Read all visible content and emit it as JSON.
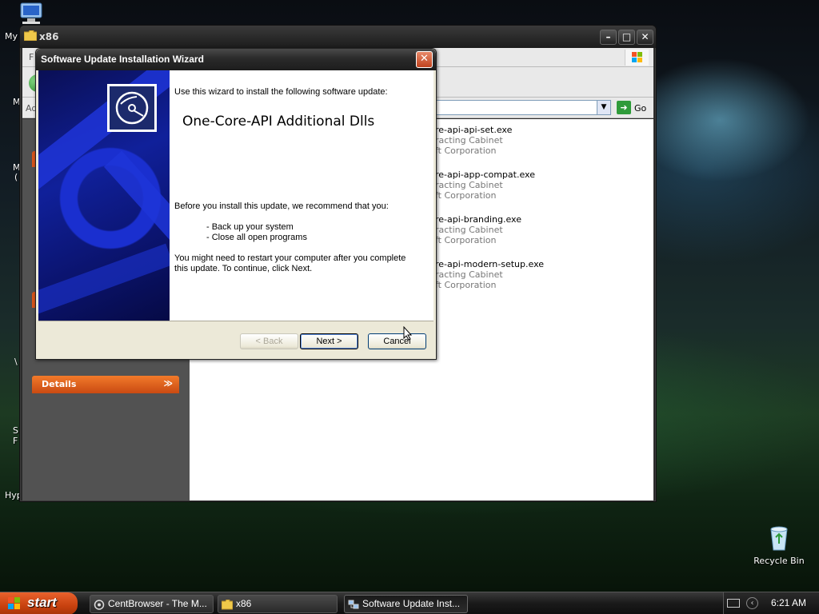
{
  "desktop": {
    "icon_fragments": [
      "My",
      "M",
      "M",
      "(",
      "S",
      "F",
      "Hyp",
      "\\"
    ],
    "recycle_bin_label": "Recycle Bin"
  },
  "explorer": {
    "title": "x86",
    "menu_fragment": "F",
    "address_label_fragment": "Ad",
    "go_label": "Go",
    "details_label": "Details",
    "files": [
      {
        "name": "re-api-api-set.exe",
        "line2": "racting Cabinet",
        "line3": "ft Corporation"
      },
      {
        "name": "re-api-app-compat.exe",
        "line2": "racting Cabinet",
        "line3": "ft Corporation"
      },
      {
        "name": "re-api-branding.exe",
        "line2": "racting Cabinet",
        "line3": "ft Corporation"
      },
      {
        "name": "re-api-modern-setup.exe",
        "line2": "racting Cabinet",
        "line3": "ft Corporation"
      }
    ]
  },
  "wizard": {
    "title": "Software Update Installation Wizard",
    "intro": "Use this wizard to install the following software update:",
    "update_name": "One-Core-API Additional Dlls",
    "recommend": "Before you install this update, we recommend that you:",
    "bullet1": "- Back up your system",
    "bullet2": "- Close all open programs",
    "restart_line1": "You might need to restart your computer after you complete",
    "restart_line2": "this update. To continue, click Next.",
    "back_label": "< Back",
    "next_label": "Next >",
    "cancel_label": "Cancel"
  },
  "taskbar": {
    "start_label": "start",
    "tasks": [
      {
        "label": "CentBrowser - The M..."
      },
      {
        "label": "x86"
      },
      {
        "label": "Software Update Inst..."
      }
    ],
    "clock": "6:21 AM"
  },
  "colors": {
    "start_orange": "#d9541a",
    "wizard_banner_blue": "#10209a",
    "xp_button_border": "#003c74"
  }
}
